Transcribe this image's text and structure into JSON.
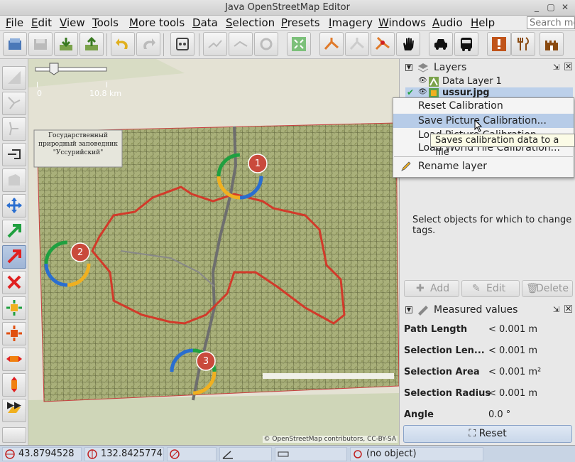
{
  "window": {
    "title": "Java OpenStreetMap Editor",
    "buttons": [
      "_",
      "▢",
      "✕"
    ]
  },
  "menu": {
    "items": [
      "File",
      "Edit",
      "View",
      "Tools",
      "More tools",
      "Data",
      "Selection",
      "Presets",
      "Imagery",
      "Windows",
      "Audio",
      "Help"
    ],
    "search_placeholder": "Search me"
  },
  "map": {
    "scale_start": "0",
    "scale_end": "10.8 km",
    "attribution": "© OpenStreetMap contributors, CC-BY-SA",
    "image_label": "Государственный природный заповедник \"Уссурийский\"",
    "markers": [
      "1",
      "2",
      "3"
    ]
  },
  "layers_panel": {
    "title": "Layers",
    "layers": [
      {
        "name": "Data Layer 1"
      },
      {
        "name": "ussur.jpg"
      }
    ]
  },
  "context_menu": {
    "items": [
      "Reset Calibration",
      "Save Picture Calibration...",
      "Load Picture Calibration...",
      "Load World File Calibration...",
      "Rename layer"
    ]
  },
  "tooltip": "Saves calibration data to a file",
  "tags_panel": {
    "hint": "Select objects for which to change tags.",
    "add_label": "Add",
    "edit_label": "Edit",
    "delete_label": "Delete"
  },
  "measured_panel": {
    "title": "Measured values",
    "rows": [
      {
        "label": "Path Length",
        "value": "< 0.001 m"
      },
      {
        "label": "Selection Len...",
        "value": "< 0.001 m"
      },
      {
        "label": "Selection Area",
        "value": "< 0.001 m²"
      },
      {
        "label": "Selection Radius",
        "value": "< 0.001 m"
      },
      {
        "label": "Angle",
        "value": "0.0 °"
      }
    ],
    "reset_label": "Reset"
  },
  "status": {
    "lat": "43.8794528",
    "lon": "132.8425774",
    "object": "(no object)"
  },
  "colors": {
    "boundary": "#d23a2a",
    "marker": "#c94a3c",
    "highlight": "#b7cce8"
  }
}
